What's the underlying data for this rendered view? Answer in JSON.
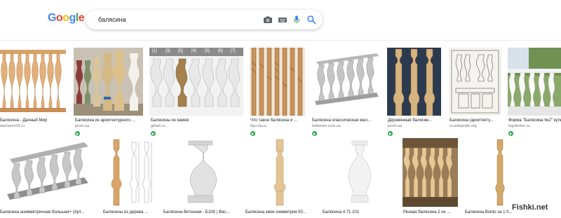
{
  "logo": {
    "letters": [
      "G",
      "o",
      "o",
      "g",
      "l",
      "e"
    ],
    "colors": [
      "#4285f4",
      "#ea4335",
      "#fbbc05",
      "#4285f4",
      "#34a853",
      "#ea4335"
    ]
  },
  "search": {
    "query": "балясина",
    "icons": [
      "camera-icon",
      "keyboard-icon",
      "microphone-icon",
      "search-icon"
    ]
  },
  "results_row1": [
    {
      "caption": "Балясина - Дачный Мир",
      "source": "dachamir33.ru"
    },
    {
      "caption": "Балясина из архитектурного ...",
      "source": "prom.ua"
    },
    {
      "caption": "Балясины из камня",
      "source": "giliam.ru",
      "labels": [
        "[1]",
        "[3]",
        "[5]",
        "[4]",
        "[5]",
        "[6]",
        "[7]"
      ]
    },
    {
      "caption": "Что такое балясина и ...",
      "source": "bip-ufa.ru"
    },
    {
      "caption": "Балясина классическая мал...",
      "source": "belbeton.com.ua"
    },
    {
      "caption": "Деревянная балясин...",
      "source": "prom.ua"
    },
    {
      "caption": "Балясина (архитекту...",
      "source": "ru.wikipedia.org"
    },
    {
      "caption": "Форма \"Балясина №2\" купить ...",
      "source": "legobeton.ru"
    }
  ],
  "results_row2": [
    {
      "caption": "Балясина асимметричная большая+ (Арт..."
    },
    {
      "caption": "Балясины из дерева ..."
    },
    {
      "caption": "Балясина бетонная - Б108 | Фас..."
    },
    {
      "caption": "Балясина хвоя симметрия 50..."
    },
    {
      "caption": "Балясина 4.71.101"
    },
    {
      "caption": "Резная балясина 2 из ..."
    },
    {
      "caption": "Балясина Bordo за 1 0..."
    }
  ],
  "watermark": "Fishki.net"
}
